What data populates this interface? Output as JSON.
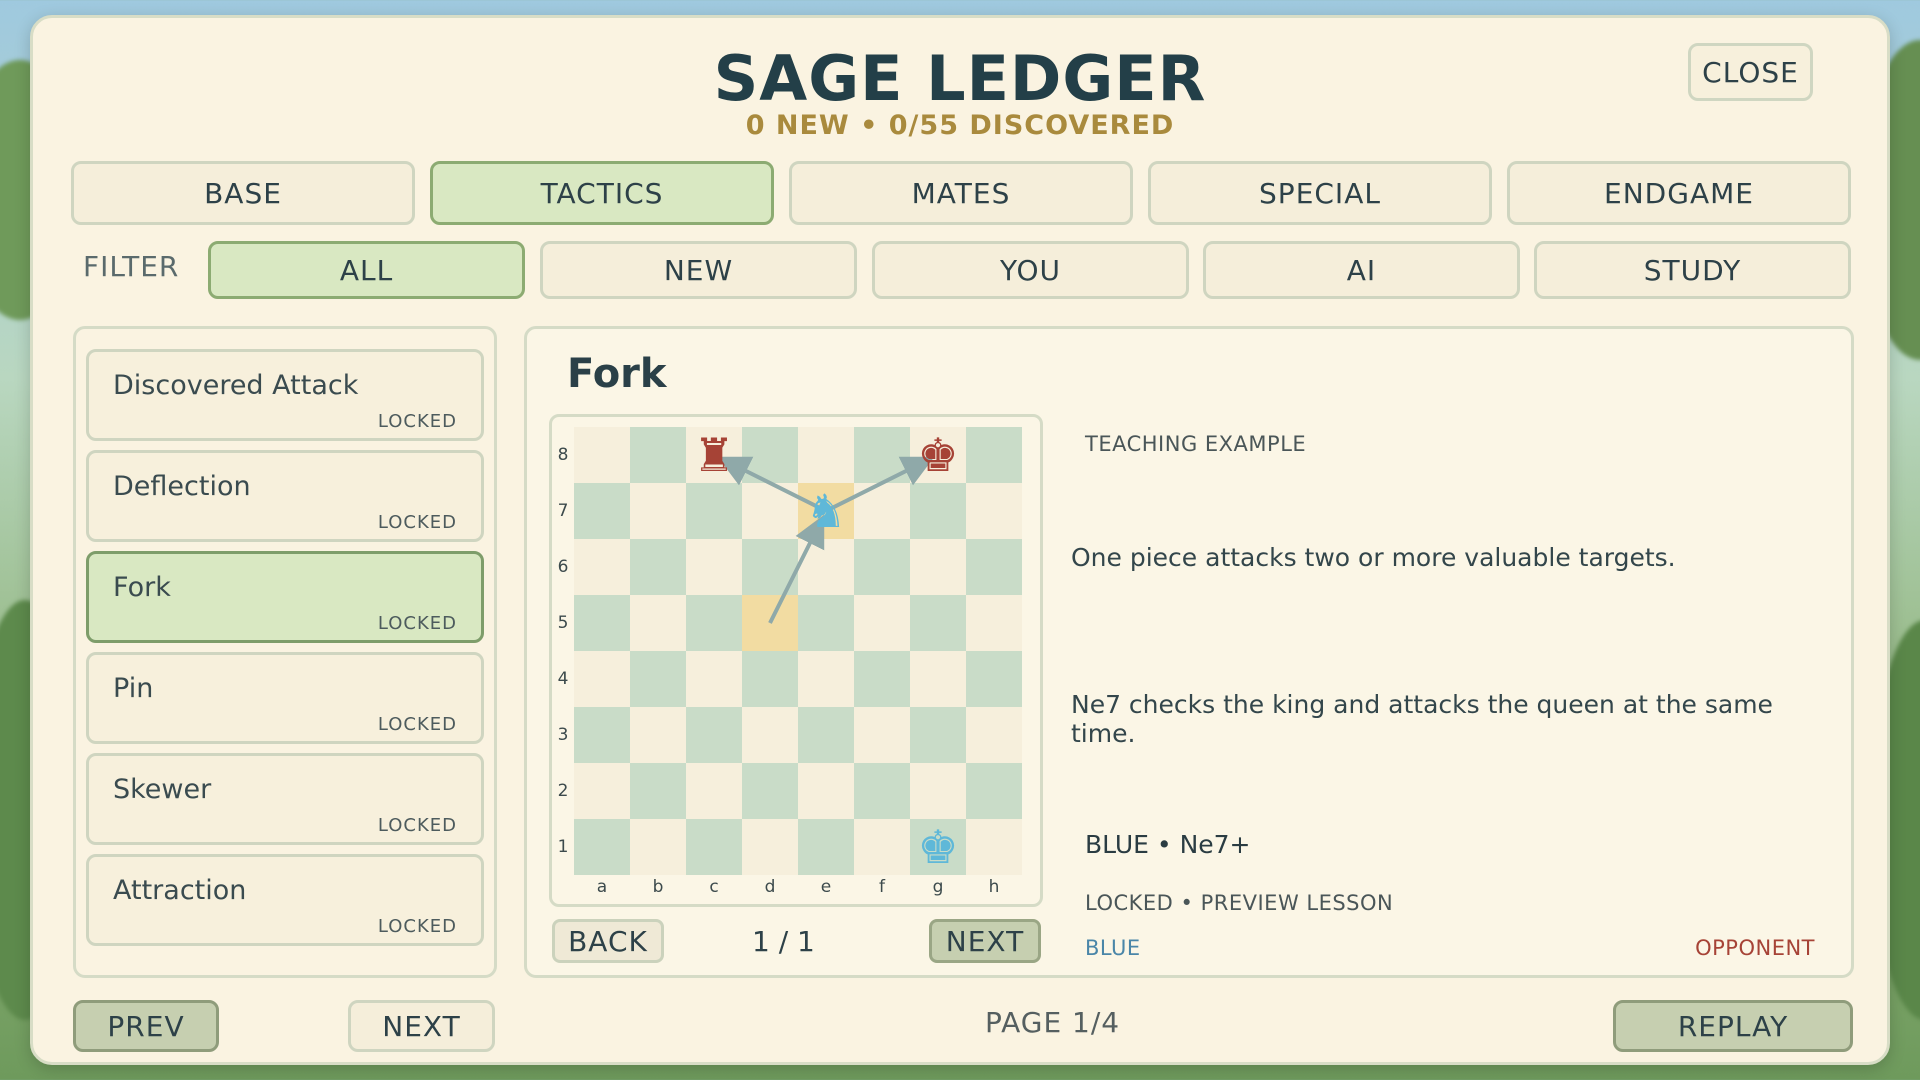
{
  "header": {
    "title": "SAGE LEDGER",
    "subtitle": "0 NEW • 0/55 DISCOVERED",
    "close_label": "CLOSE"
  },
  "tabs": [
    {
      "label": "BASE",
      "active": false
    },
    {
      "label": "TACTICS",
      "active": true
    },
    {
      "label": "MATES",
      "active": false
    },
    {
      "label": "SPECIAL",
      "active": false
    },
    {
      "label": "ENDGAME",
      "active": false
    }
  ],
  "filter": {
    "label": "FILTER",
    "options": [
      {
        "label": "ALL",
        "active": true
      },
      {
        "label": "NEW",
        "active": false
      },
      {
        "label": "YOU",
        "active": false
      },
      {
        "label": "AI",
        "active": false
      },
      {
        "label": "STUDY",
        "active": false
      }
    ]
  },
  "list": {
    "items": [
      {
        "name": "Discovered Attack",
        "status": "LOCKED",
        "selected": false
      },
      {
        "name": "Deflection",
        "status": "LOCKED",
        "selected": false
      },
      {
        "name": "Fork",
        "status": "LOCKED",
        "selected": true
      },
      {
        "name": "Pin",
        "status": "LOCKED",
        "selected": false
      },
      {
        "name": "Skewer",
        "status": "LOCKED",
        "selected": false
      },
      {
        "name": "Attraction",
        "status": "LOCKED",
        "selected": false
      }
    ],
    "prev_label": "PREV",
    "next_label": "NEXT",
    "page_label": "PAGE 1/4"
  },
  "detail": {
    "title": "Fork",
    "teaching_label": "TEACHING EXAMPLE",
    "summary": "One piece attacks two or more valuable targets.",
    "explanation": "Ne7 checks the king and attacks the queen at the same time.",
    "move_text": "BLUE • Ne7+",
    "lock_text": "LOCKED • PREVIEW LESSON",
    "player_label": "BLUE",
    "opponent_label": "OPPONENT",
    "back_label": "BACK",
    "next_label": "NEXT",
    "counter": "1 / 1",
    "replay_label": "REPLAY",
    "colors": {
      "player": "#4a86a8",
      "opponent": "#a64336"
    }
  },
  "board": {
    "files": [
      "a",
      "b",
      "c",
      "d",
      "e",
      "f",
      "g",
      "h"
    ],
    "ranks": [
      "8",
      "7",
      "6",
      "5",
      "4",
      "3",
      "2",
      "1"
    ],
    "highlight_squares": [
      "e7",
      "d5"
    ],
    "pieces": [
      {
        "square": "c8",
        "piece": "rook",
        "side": "opponent",
        "glyph": "♜"
      },
      {
        "square": "g8",
        "piece": "king",
        "side": "opponent",
        "glyph": "♚"
      },
      {
        "square": "e7",
        "piece": "knight",
        "side": "player",
        "glyph": "♞"
      },
      {
        "square": "g1",
        "piece": "king",
        "side": "player",
        "glyph": "♚"
      }
    ],
    "arrows": [
      {
        "from": "d5",
        "to": "e7"
      },
      {
        "from": "e7",
        "to": "c8"
      },
      {
        "from": "e7",
        "to": "g8"
      }
    ]
  }
}
